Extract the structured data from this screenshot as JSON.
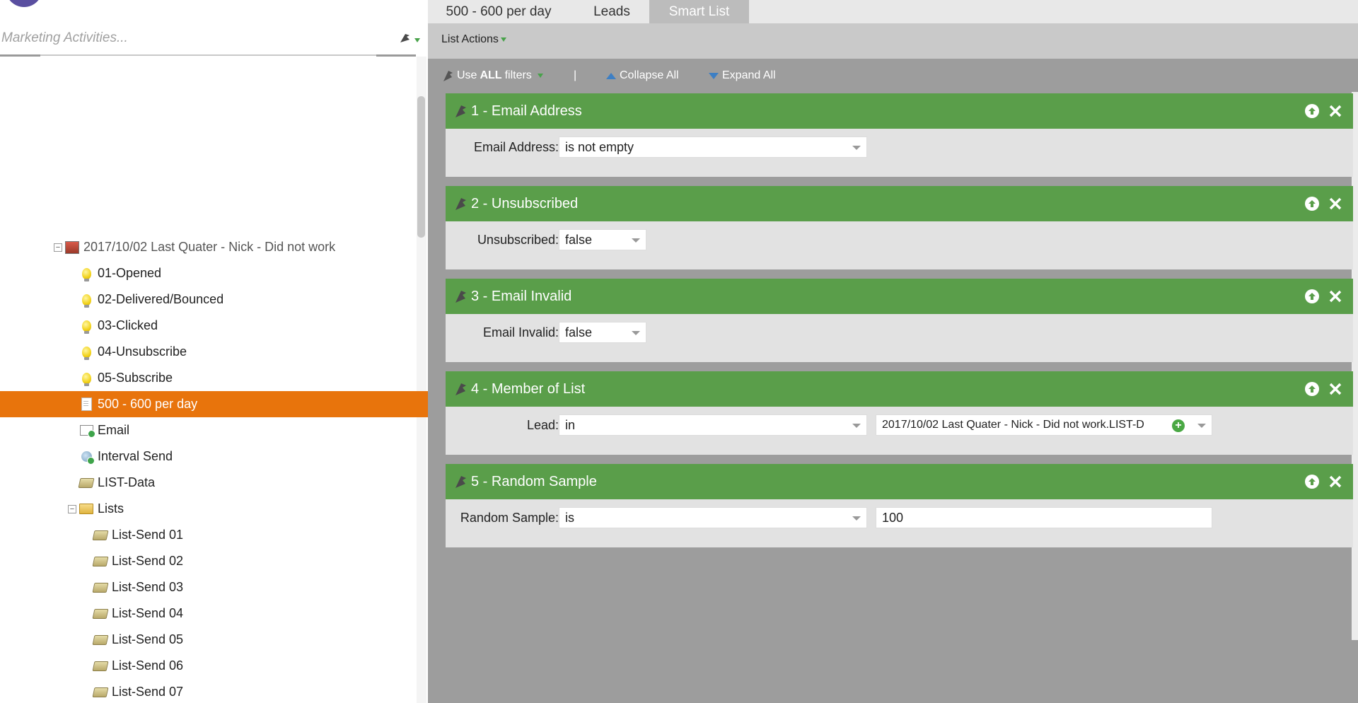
{
  "search": {
    "placeholder": "Marketing Activities..."
  },
  "tree": {
    "program": "2017/10/02 Last Quater - Nick - Did not work",
    "items": [
      {
        "label": "01-Opened",
        "icon": "bulb-icon"
      },
      {
        "label": "02-Delivered/Bounced",
        "icon": "bulb-icon"
      },
      {
        "label": "03-Clicked",
        "icon": "bulb-icon"
      },
      {
        "label": "04-Unsubscribe",
        "icon": "bulb-icon"
      },
      {
        "label": "05-Subscribe",
        "icon": "bulb-icon"
      },
      {
        "label": "500 - 600 per day",
        "icon": "smart-list-icon",
        "selected": true
      },
      {
        "label": "Email",
        "icon": "email-icon"
      },
      {
        "label": "Interval Send",
        "icon": "campaign-icon"
      },
      {
        "label": "LIST-Data",
        "icon": "list-icon"
      }
    ],
    "folder": "Lists",
    "lists": [
      "List-Send 01",
      "List-Send 02",
      "List-Send 03",
      "List-Send 04",
      "List-Send 05",
      "List-Send 06",
      "List-Send 07"
    ]
  },
  "tabs": [
    {
      "label": "500 - 600 per day",
      "active": false
    },
    {
      "label": "Leads",
      "active": false
    },
    {
      "label": "Smart List",
      "active": true
    }
  ],
  "subbar": {
    "list_actions": "List Actions"
  },
  "toolbar": {
    "use_prefix": "Use",
    "use_bold": "ALL",
    "use_suffix": "filters",
    "separator": "|",
    "collapse_all": "Collapse All",
    "expand_all": "Expand All"
  },
  "filters": [
    {
      "title": "1 - Email Address",
      "label": "Email Address:",
      "operator": "is not empty"
    },
    {
      "title": "2 - Unsubscribed",
      "label": "Unsubscribed:",
      "operator": "false"
    },
    {
      "title": "3 - Email Invalid",
      "label": "Email Invalid:",
      "operator": "false"
    },
    {
      "title": "4 - Member of List",
      "label": "Lead:",
      "operator": "in",
      "value": "2017/10/02 Last Quater - Nick - Did not work.LIST-D"
    },
    {
      "title": "5 - Random Sample",
      "label": "Random Sample:",
      "operator": "is",
      "value": "100"
    }
  ],
  "colors": {
    "selected": "#e8740c",
    "filter_header": "#5a9e4a",
    "panel_bg": "#9d9d9d"
  }
}
